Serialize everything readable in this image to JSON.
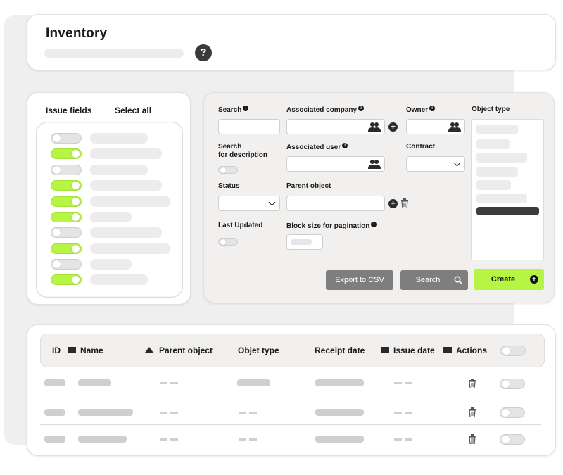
{
  "header": {
    "title": "Inventory",
    "help_icon": "?"
  },
  "issue_fields": {
    "title": "Issue fields",
    "select_all": "Select all",
    "toggles": [
      false,
      true,
      false,
      true,
      true,
      true,
      false,
      true,
      false,
      true
    ]
  },
  "search": {
    "search_label": "Search",
    "associated_company_label": "Associated company",
    "owner_label": "Owner",
    "object_type_label": "Object type",
    "search_desc_label_line1": "Search",
    "search_desc_label_line2": "for description",
    "associated_user_label": "Associated user",
    "contract_label": "Contract",
    "status_label": "Status",
    "parent_object_label": "Parent object",
    "last_updated_label": "Last Updated",
    "block_size_label": "Block size for pagination",
    "info_glyph": "i",
    "plus_glyph": "+",
    "export_button": "Export to CSV",
    "search_button": "Search",
    "create_button": "Create"
  },
  "table": {
    "columns": [
      "ID",
      "Name",
      "Parent object",
      "Objet type",
      "Receipt date",
      "Issue date",
      "Actions"
    ],
    "header_toggle": false,
    "rows": 3
  },
  "colors": {
    "accent": "#b6f544",
    "dark": "#2a2a2a",
    "panel": "#f1f0ef"
  },
  "icons": [
    "help-icon",
    "info-icon",
    "people-icon",
    "plus-icon",
    "trash-icon",
    "search-icon",
    "chevron-down-icon",
    "sort-asc-icon"
  ]
}
